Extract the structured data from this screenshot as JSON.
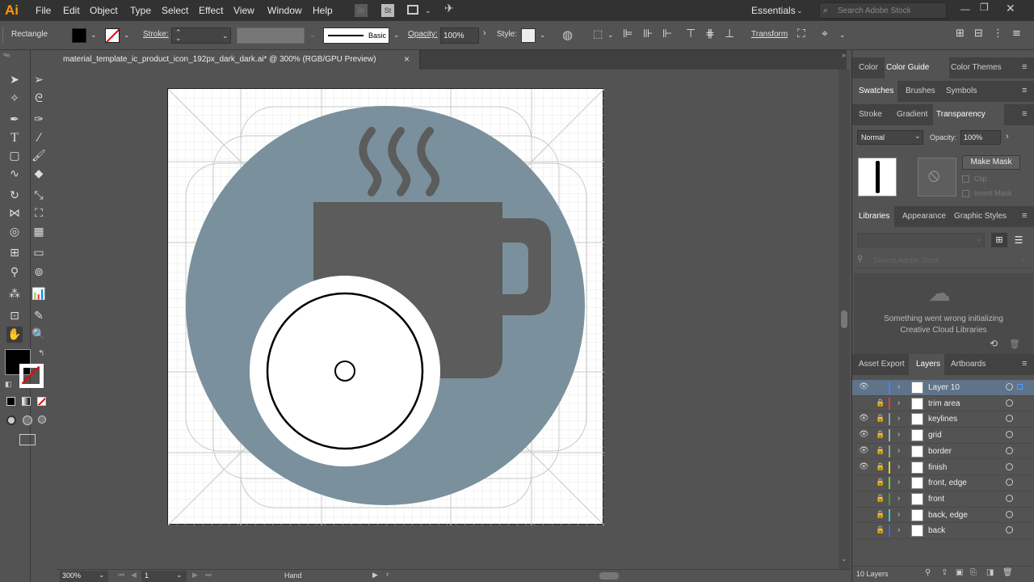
{
  "app": {
    "logo": "Ai"
  },
  "menu": [
    "File",
    "Edit",
    "Object",
    "Type",
    "Select",
    "Effect",
    "View",
    "Window",
    "Help"
  ],
  "menu_right": {
    "badge_br": "Br",
    "badge_st": "St",
    "workspace": "Essentials",
    "search_placeholder": "Search Adobe Stock"
  },
  "control": {
    "tool_name": "Rectangle",
    "stroke_label": "Stroke:",
    "brush_label": "Basic",
    "opacity_label": "Opacity:",
    "opacity_value": "100%",
    "style_label": "Style:",
    "transform_label": "Transform"
  },
  "document": {
    "tab_title": "material_template_ic_product_icon_192px_dark_dark.ai* @ 300% (RGB/GPU Preview)",
    "close": "×"
  },
  "status": {
    "zoom": "300%",
    "page": "1",
    "tool": "Hand"
  },
  "panels": {
    "row1_tabs": [
      "Color",
      "Color Guide",
      "Color Themes"
    ],
    "row2_tabs": [
      "Swatches",
      "Brushes",
      "Symbols"
    ],
    "row3_tabs": [
      "Stroke",
      "Gradient",
      "Transparency"
    ],
    "transparency": {
      "blend_mode": "Normal",
      "opacity_label": "Opacity:",
      "opacity_value": "100%",
      "make_mask": "Make Mask",
      "clip": "Clip",
      "invert_mask": "Invert Mask"
    },
    "row4_tabs": [
      "Libraries",
      "Appearance",
      "Graphic Styles"
    ],
    "libraries": {
      "search_placeholder": "Search Adobe Stock",
      "error_line1": "Something went wrong initializing",
      "error_line2": "Creative Cloud Libraries"
    },
    "row5_tabs": [
      "Asset Export",
      "Layers",
      "Artboards"
    ],
    "layers": [
      {
        "name": "Layer 10",
        "visible": true,
        "locked": false,
        "color": "#4a7fff",
        "selected": true
      },
      {
        "name": "trim area",
        "visible": false,
        "locked": true,
        "color": "#e83a3a"
      },
      {
        "name": "keylines",
        "visible": true,
        "locked": true,
        "color": "#9a9a9a"
      },
      {
        "name": "grid",
        "visible": true,
        "locked": true,
        "color": "#aaaaaa"
      },
      {
        "name": "border",
        "visible": true,
        "locked": true,
        "color": "#9a9a9a"
      },
      {
        "name": "finish",
        "visible": true,
        "locked": true,
        "color": "#d9d13a"
      },
      {
        "name": "front, edge",
        "visible": false,
        "locked": true,
        "color": "#7ec83a"
      },
      {
        "name": "front",
        "visible": false,
        "locked": true,
        "color": "#3aa03a"
      },
      {
        "name": "back, edge",
        "visible": false,
        "locked": true,
        "color": "#3ac8c8"
      },
      {
        "name": "back",
        "visible": false,
        "locked": true,
        "color": "#3a6ad9"
      }
    ],
    "layers_count": "10 Layers"
  },
  "colors": {
    "circle_fill": "#7a909c",
    "mug_fill": "#5c5c5c",
    "accent_orange": "#ff9a00"
  }
}
